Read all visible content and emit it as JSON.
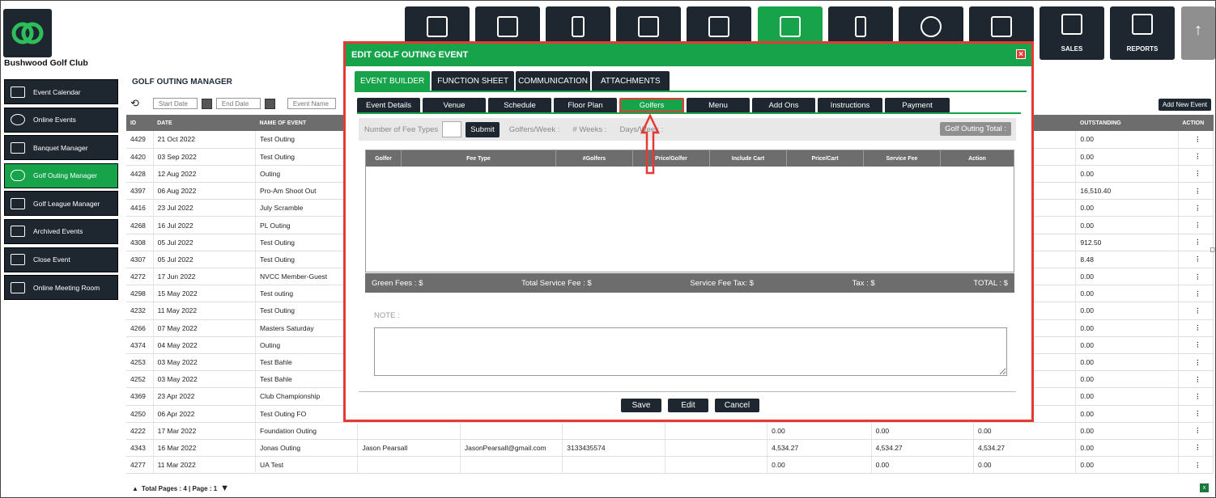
{
  "club_name": "Bushwood Golf Club",
  "top_nav": [
    {
      "icon": "barcode-scanner-icon",
      "label": ""
    },
    {
      "icon": "flag-icon",
      "label": ""
    },
    {
      "icon": "tablet-icon",
      "label": ""
    },
    {
      "icon": "calendar-list-icon",
      "label": ""
    },
    {
      "icon": "group-icon",
      "label": ""
    },
    {
      "icon": "calendar-edit-icon",
      "label": "",
      "active": true
    },
    {
      "icon": "phone-icon",
      "label": ""
    },
    {
      "icon": "users-icon",
      "label": ""
    },
    {
      "icon": "newspaper-icon",
      "label": ""
    },
    {
      "icon": "sales-icon",
      "label": "SALES"
    },
    {
      "icon": "reports-icon",
      "label": "REPORTS"
    },
    {
      "icon": "arrow-up-icon",
      "label": "↑"
    }
  ],
  "sidebar": [
    {
      "label": "Event Calendar",
      "icon": "calendar-icon"
    },
    {
      "label": "Online Events",
      "icon": "globe-icon"
    },
    {
      "label": "Banquet Manager",
      "icon": "star-calendar-icon"
    },
    {
      "label": "Golf Outing Manager",
      "icon": "golf-club-icon",
      "active": true
    },
    {
      "label": "Golf League Manager",
      "icon": "list-calendar-icon"
    },
    {
      "label": "Archived Events",
      "icon": "archive-calendar-icon"
    },
    {
      "label": "Close Event",
      "icon": "close-calendar-icon"
    },
    {
      "label": "Online Meeting Room",
      "icon": "video-icon"
    }
  ],
  "manager_title": "GOLF OUTING MANAGER",
  "filters": {
    "start_date": "Start Date",
    "end_date": "End Date",
    "event_name": "Event Name"
  },
  "add_new_label": "Add New Event",
  "table": {
    "headers": [
      "ID",
      "DATE",
      "NAME OF EVENT",
      "",
      "",
      "",
      "",
      "",
      "",
      "",
      "OUTSTANDING",
      "ACTION"
    ],
    "rows": [
      [
        "4429",
        "21 Oct 2022",
        "Test Outing",
        "",
        "",
        "",
        "",
        "",
        "",
        "",
        "0.00",
        "⋮"
      ],
      [
        "4420",
        "03 Sep 2022",
        "Test Outing",
        "",
        "",
        "",
        "",
        "",
        "",
        "",
        "0.00",
        "⋮"
      ],
      [
        "4428",
        "12 Aug 2022",
        "Outing",
        "",
        "",
        "",
        "",
        "",
        "",
        "",
        "0.00",
        "⋮"
      ],
      [
        "4397",
        "06 Aug 2022",
        "Pro-Am Shoot Out",
        "",
        "",
        "",
        "",
        "",
        "",
        "",
        "16,510.40",
        "⋮"
      ],
      [
        "4416",
        "23 Jul 2022",
        "July Scramble",
        "",
        "",
        "",
        "",
        "",
        "",
        "",
        "0.00",
        "⋮"
      ],
      [
        "4268",
        "16 Jul 2022",
        "PL Outing",
        "",
        "",
        "",
        "",
        "",
        "",
        "",
        "0.00",
        "⋮"
      ],
      [
        "4308",
        "05 Jul 2022",
        "Test Outing",
        "",
        "",
        "",
        "",
        "",
        "",
        "",
        "912.50",
        "⋮"
      ],
      [
        "4307",
        "05 Jul 2022",
        "Test Outing",
        "",
        "",
        "",
        "",
        "",
        "",
        "",
        "8.48",
        "⋮"
      ],
      [
        "4272",
        "17 Jun 2022",
        "NVCC Member-Guest",
        "",
        "",
        "",
        "",
        "",
        "",
        "",
        "0.00",
        "⋮"
      ],
      [
        "4298",
        "15 May 2022",
        "Test outing",
        "",
        "",
        "",
        "",
        "",
        "",
        "",
        "0.00",
        "⋮"
      ],
      [
        "4232",
        "11 May 2022",
        "Test Outing",
        "",
        "",
        "",
        "",
        "",
        "",
        "",
        "0.00",
        "⋮"
      ],
      [
        "4266",
        "07 May 2022",
        "Masters Saturday",
        "",
        "",
        "",
        "",
        "",
        "",
        "",
        "0.00",
        "⋮"
      ],
      [
        "4374",
        "04 May 2022",
        "Outing",
        "",
        "",
        "",
        "",
        "",
        "",
        "",
        "0.00",
        "⋮"
      ],
      [
        "4253",
        "03 May 2022",
        "Test Bahle",
        "",
        "",
        "",
        "",
        "",
        "",
        "",
        "0.00",
        "⋮"
      ],
      [
        "4252",
        "03 May 2022",
        "Test Bahle",
        "",
        "",
        "",
        "",
        "",
        "",
        "",
        "0.00",
        "⋮"
      ],
      [
        "4369",
        "23 Apr 2022",
        "Club Championship",
        "",
        "",
        "",
        "",
        "",
        "",
        "",
        "0.00",
        "⋮"
      ],
      [
        "4250",
        "06 Apr 2022",
        "Test Outing FO",
        "",
        "",
        "",
        "",
        "",
        "",
        "",
        "0.00",
        "⋮"
      ],
      [
        "4222",
        "17 Mar 2022",
        "Foundation Outing",
        "",
        "",
        "",
        "",
        "0.00",
        "0.00",
        "0.00",
        "0.00",
        "⋮"
      ],
      [
        "4343",
        "16 Mar 2022",
        "Jonas Outing",
        "Jason Pearsall",
        "JasonPearsall@gmail.com",
        "3133435574",
        "",
        "4,534.27",
        "4,534.27",
        "4,534.27",
        "0.00",
        "⋮"
      ],
      [
        "4277",
        "11 Mar 2022",
        "UA Test",
        "",
        "",
        "",
        "",
        "0.00",
        "0.00",
        "0.00",
        "0.00",
        "⋮"
      ]
    ]
  },
  "pager_text": "Total Pages : 4 | Page : 1",
  "modal": {
    "title": "EDIT GOLF OUTING EVENT",
    "close": "×",
    "main_tabs": [
      "EVENT BUILDER",
      "FUNCTION SHEET",
      "COMMUNICATION",
      "ATTACHMENTS"
    ],
    "sub_tabs": [
      "Event Details",
      "Venue",
      "Schedule",
      "Floor Plan",
      "Golfers",
      "Menu",
      "Add Ons",
      "Instructions",
      "Payment"
    ],
    "fee_types_label": "Number of Fee Types",
    "submit_label": "Submit",
    "golfers_week": "Golfers/Week :",
    "weeks": "# Weeks :",
    "days_week": "Days/Week :",
    "golf_outing_total": "Golf Outing Total :",
    "golfer_headers": [
      "Golfer",
      "Fee Type",
      "#Golfers",
      "Price/Golfer",
      "Include Cart",
      "Price/Cart",
      "Service Fee",
      "Action"
    ],
    "totals": {
      "green_fees": "Green Fees : $",
      "service_fee": "Total Service Fee : $",
      "service_fee_tax": "Service Fee Tax: $",
      "tax": "Tax : $",
      "total": "TOTAL : $"
    },
    "note_label": "NOTE :",
    "buttons": [
      "Save",
      "Edit",
      "Cancel"
    ]
  },
  "colors": {
    "dark": "#1e2630",
    "green": "#16a34a",
    "red": "#e53935",
    "gray": "#6d6d6d"
  }
}
